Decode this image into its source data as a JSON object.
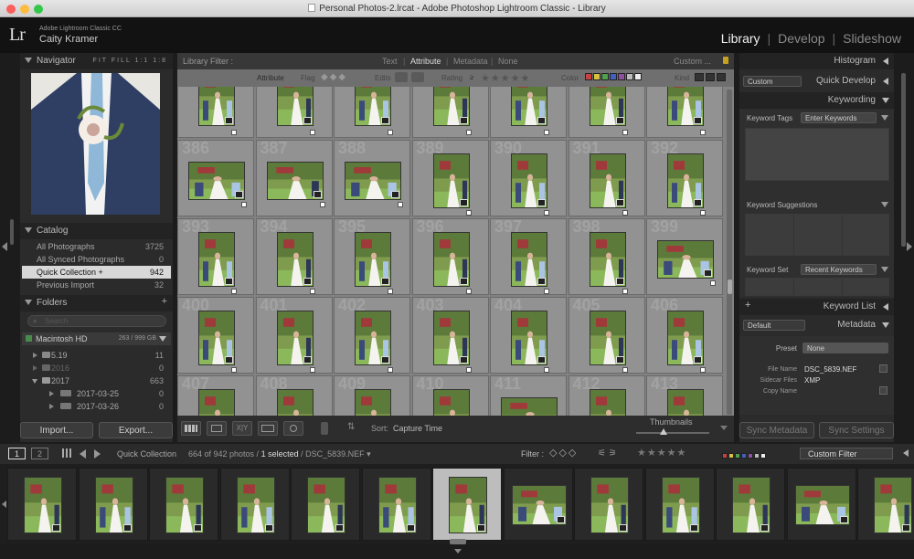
{
  "window": {
    "title": "Personal Photos-2.lrcat - Adobe Photoshop Lightroom Classic - Library"
  },
  "identity": {
    "logo": "Lr",
    "app_name": "Adobe Lightroom Classic CC",
    "user_name": "Caity Kramer",
    "modules": [
      "Library",
      "Develop",
      "Slideshow"
    ],
    "active_module": "Library"
  },
  "navigator": {
    "title": "Navigator",
    "zoom_options": [
      "FIT",
      "FILL",
      "1:1",
      "1:8"
    ]
  },
  "catalog": {
    "title": "Catalog",
    "items": [
      {
        "label": "All Photographs",
        "count": "3725"
      },
      {
        "label": "All Synced Photographs",
        "count": "0"
      },
      {
        "label": "Quick Collection +",
        "count": "942"
      },
      {
        "label": "Previous Import",
        "count": "32"
      }
    ],
    "selected_index": 2
  },
  "folders": {
    "title": "Folders",
    "add": "+",
    "search_placeholder": "Search",
    "volume": {
      "name": "Macintosh HD",
      "size": "263 / 999 GB"
    },
    "items": [
      {
        "label": "5.19",
        "count": "11"
      },
      {
        "label": "2016",
        "count": "0"
      },
      {
        "label": "2017",
        "count": "663"
      },
      {
        "label": "2017-03-25",
        "count": "0"
      },
      {
        "label": "2017-03-26",
        "count": "0"
      }
    ]
  },
  "left_buttons": {
    "import": "Import...",
    "export": "Export..."
  },
  "library_filter": {
    "label": "Library Filter :",
    "tabs": [
      "Text",
      "Attribute",
      "Metadata",
      "None"
    ],
    "active_tab": "Attribute",
    "preset": "Custom ...",
    "attribute_row": {
      "attribute": "Attribute",
      "flag": "Flag",
      "edits": "Edits",
      "rating": "Rating",
      "rating_op": "≥",
      "stars": "★★★★★",
      "color": "Color",
      "kind": "Kind"
    },
    "color_swatches": [
      "#c84040",
      "#d8c040",
      "#50a050",
      "#4060c0",
      "#9050a0",
      "#bbbbbb",
      "#eeeeee"
    ]
  },
  "grid": {
    "numbers": [
      "386",
      "387",
      "388",
      "389",
      "390",
      "391",
      "392",
      "393",
      "394",
      "395",
      "396",
      "397",
      "398",
      "399",
      "400",
      "401",
      "402",
      "403",
      "404",
      "405",
      "406",
      "407",
      "408",
      "409",
      "410",
      "411",
      "412",
      "413"
    ]
  },
  "toolbar": {
    "sort_label": "Sort:",
    "sort_value": "Capture Time",
    "thumbnails_label": "Thumbnails"
  },
  "right_panel": {
    "histogram": "Histogram",
    "quick_develop": {
      "title": "Quick Develop",
      "preset": "Custom"
    },
    "keywording": {
      "title": "Keywording",
      "keyword_tags_label": "Keyword Tags",
      "keyword_tags_value": "Enter Keywords",
      "suggestions_label": "Keyword Suggestions",
      "keyword_set_label": "Keyword Set",
      "keyword_set_value": "Recent Keywords"
    },
    "keyword_list": {
      "title": "Keyword List",
      "add": "+"
    },
    "metadata": {
      "title": "Metadata",
      "preset_select": "Default",
      "preset_label": "Preset",
      "preset_value": "None",
      "fields": [
        {
          "label": "File Name",
          "value": "DSC_5839.NEF"
        },
        {
          "label": "Sidecar Files",
          "value": "XMP"
        },
        {
          "label": "Copy Name",
          "value": ""
        }
      ]
    },
    "sync_metadata": "Sync Metadata",
    "sync_settings": "Sync Settings"
  },
  "filmstrip_bar": {
    "page1": "1",
    "page2": "2",
    "source": "Quick Collection",
    "count_text": "664 of 942 photos /",
    "selected_text": "1 selected",
    "file_text": "/ DSC_5839.NEF",
    "filter_label": "Filter :",
    "filter_preset": "Custom Filter"
  }
}
